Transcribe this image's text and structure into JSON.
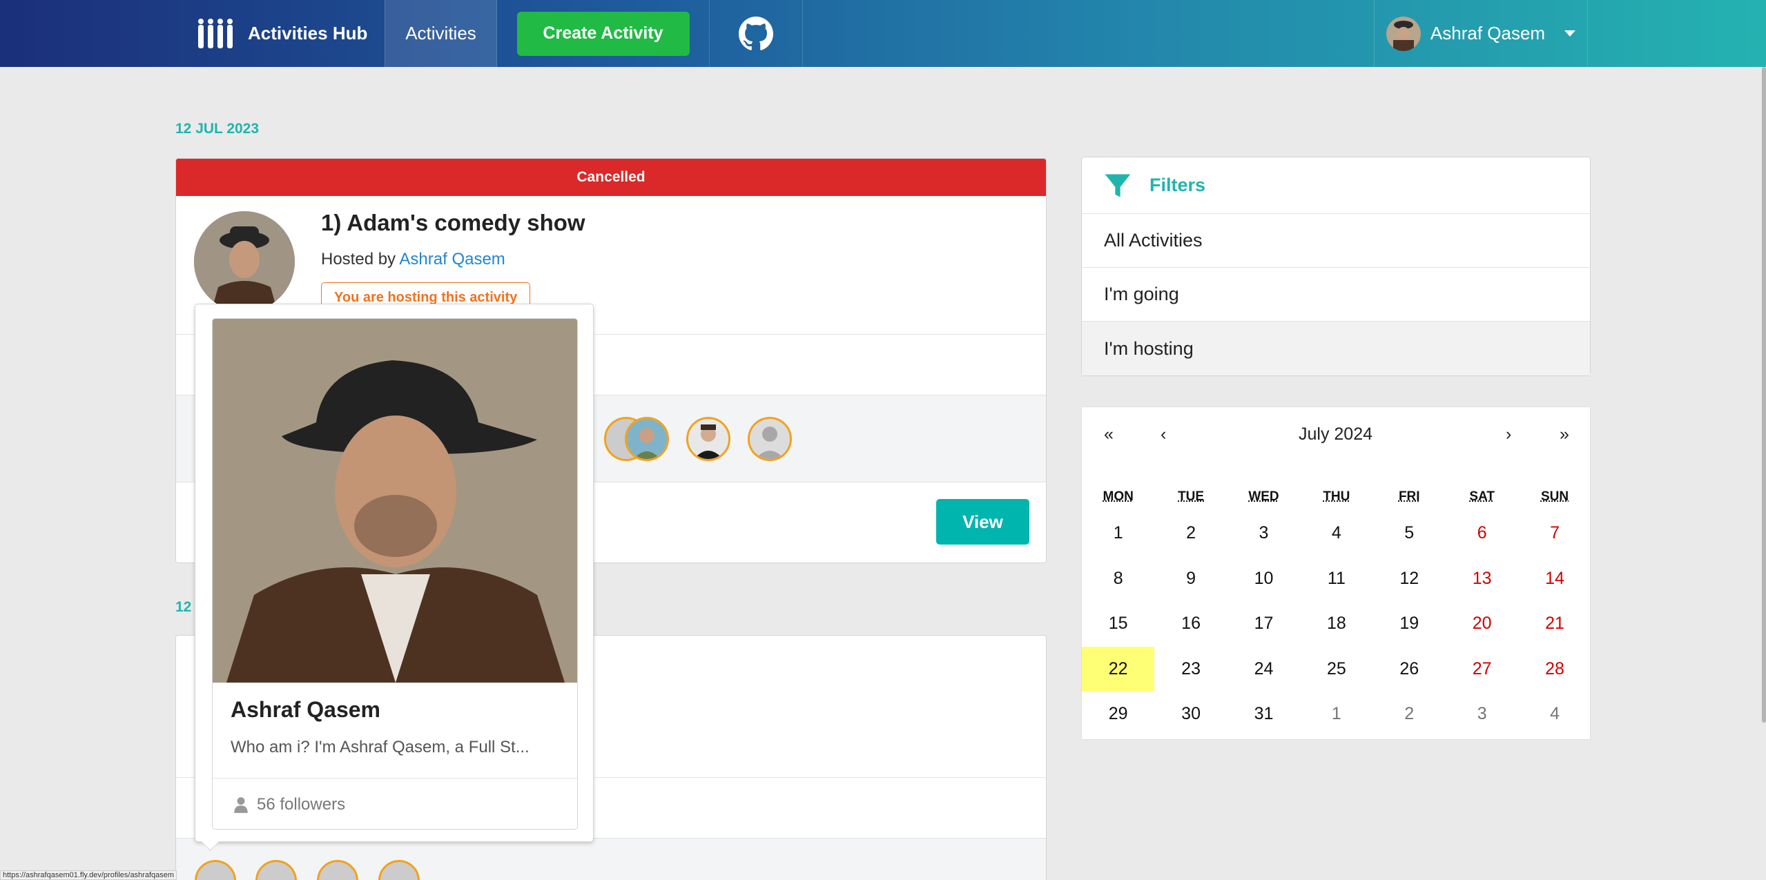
{
  "nav": {
    "brand": "Activities Hub",
    "activities": "Activities",
    "create": "Create Activity",
    "user_name": "Ashraf Qasem"
  },
  "list": {
    "date_1": "12 JUL 2023",
    "date_2": "12"
  },
  "activity": {
    "status": "Cancelled",
    "title": "1) Adam's comedy show",
    "hosted_prefix": "Hosted by ",
    "host_name": "Ashraf Qasem",
    "hosting_label": "You are hosting this activity",
    "view": "View"
  },
  "filters": {
    "title": "Filters",
    "items": [
      "All Activities",
      "I'm going",
      "I'm hosting"
    ],
    "active_index": 2
  },
  "calendar": {
    "prev_year": "«",
    "prev_month": "‹",
    "month_label": "July 2024",
    "next_month": "›",
    "next_year": "»",
    "weekdays": [
      "MON",
      "TUE",
      "WED",
      "THU",
      "FRI",
      "SAT",
      "SUN"
    ],
    "weeks": [
      [
        "1",
        "2",
        "3",
        "4",
        "5",
        "6",
        "7"
      ],
      [
        "8",
        "9",
        "10",
        "11",
        "12",
        "13",
        "14"
      ],
      [
        "15",
        "16",
        "17",
        "18",
        "19",
        "20",
        "21"
      ],
      [
        "22",
        "23",
        "24",
        "25",
        "26",
        "27",
        "28"
      ],
      [
        "29",
        "30",
        "31",
        "1",
        "2",
        "3",
        "4"
      ]
    ],
    "today": "22"
  },
  "profile_popup": {
    "name": "Ashraf Qasem",
    "bio": "Who am i? I'm Ashraf Qasem, a Full St...",
    "followers": "56 followers"
  },
  "status_url": "https://ashrafqasem01.fly.dev/profiles/ashrafqasem",
  "colors": {
    "accent": "#1fb5ad",
    "create_green": "#21ba45",
    "cancel_red": "#db2828",
    "today_yellow": "#ffff76",
    "attendee_ring": "#f2a21c"
  }
}
